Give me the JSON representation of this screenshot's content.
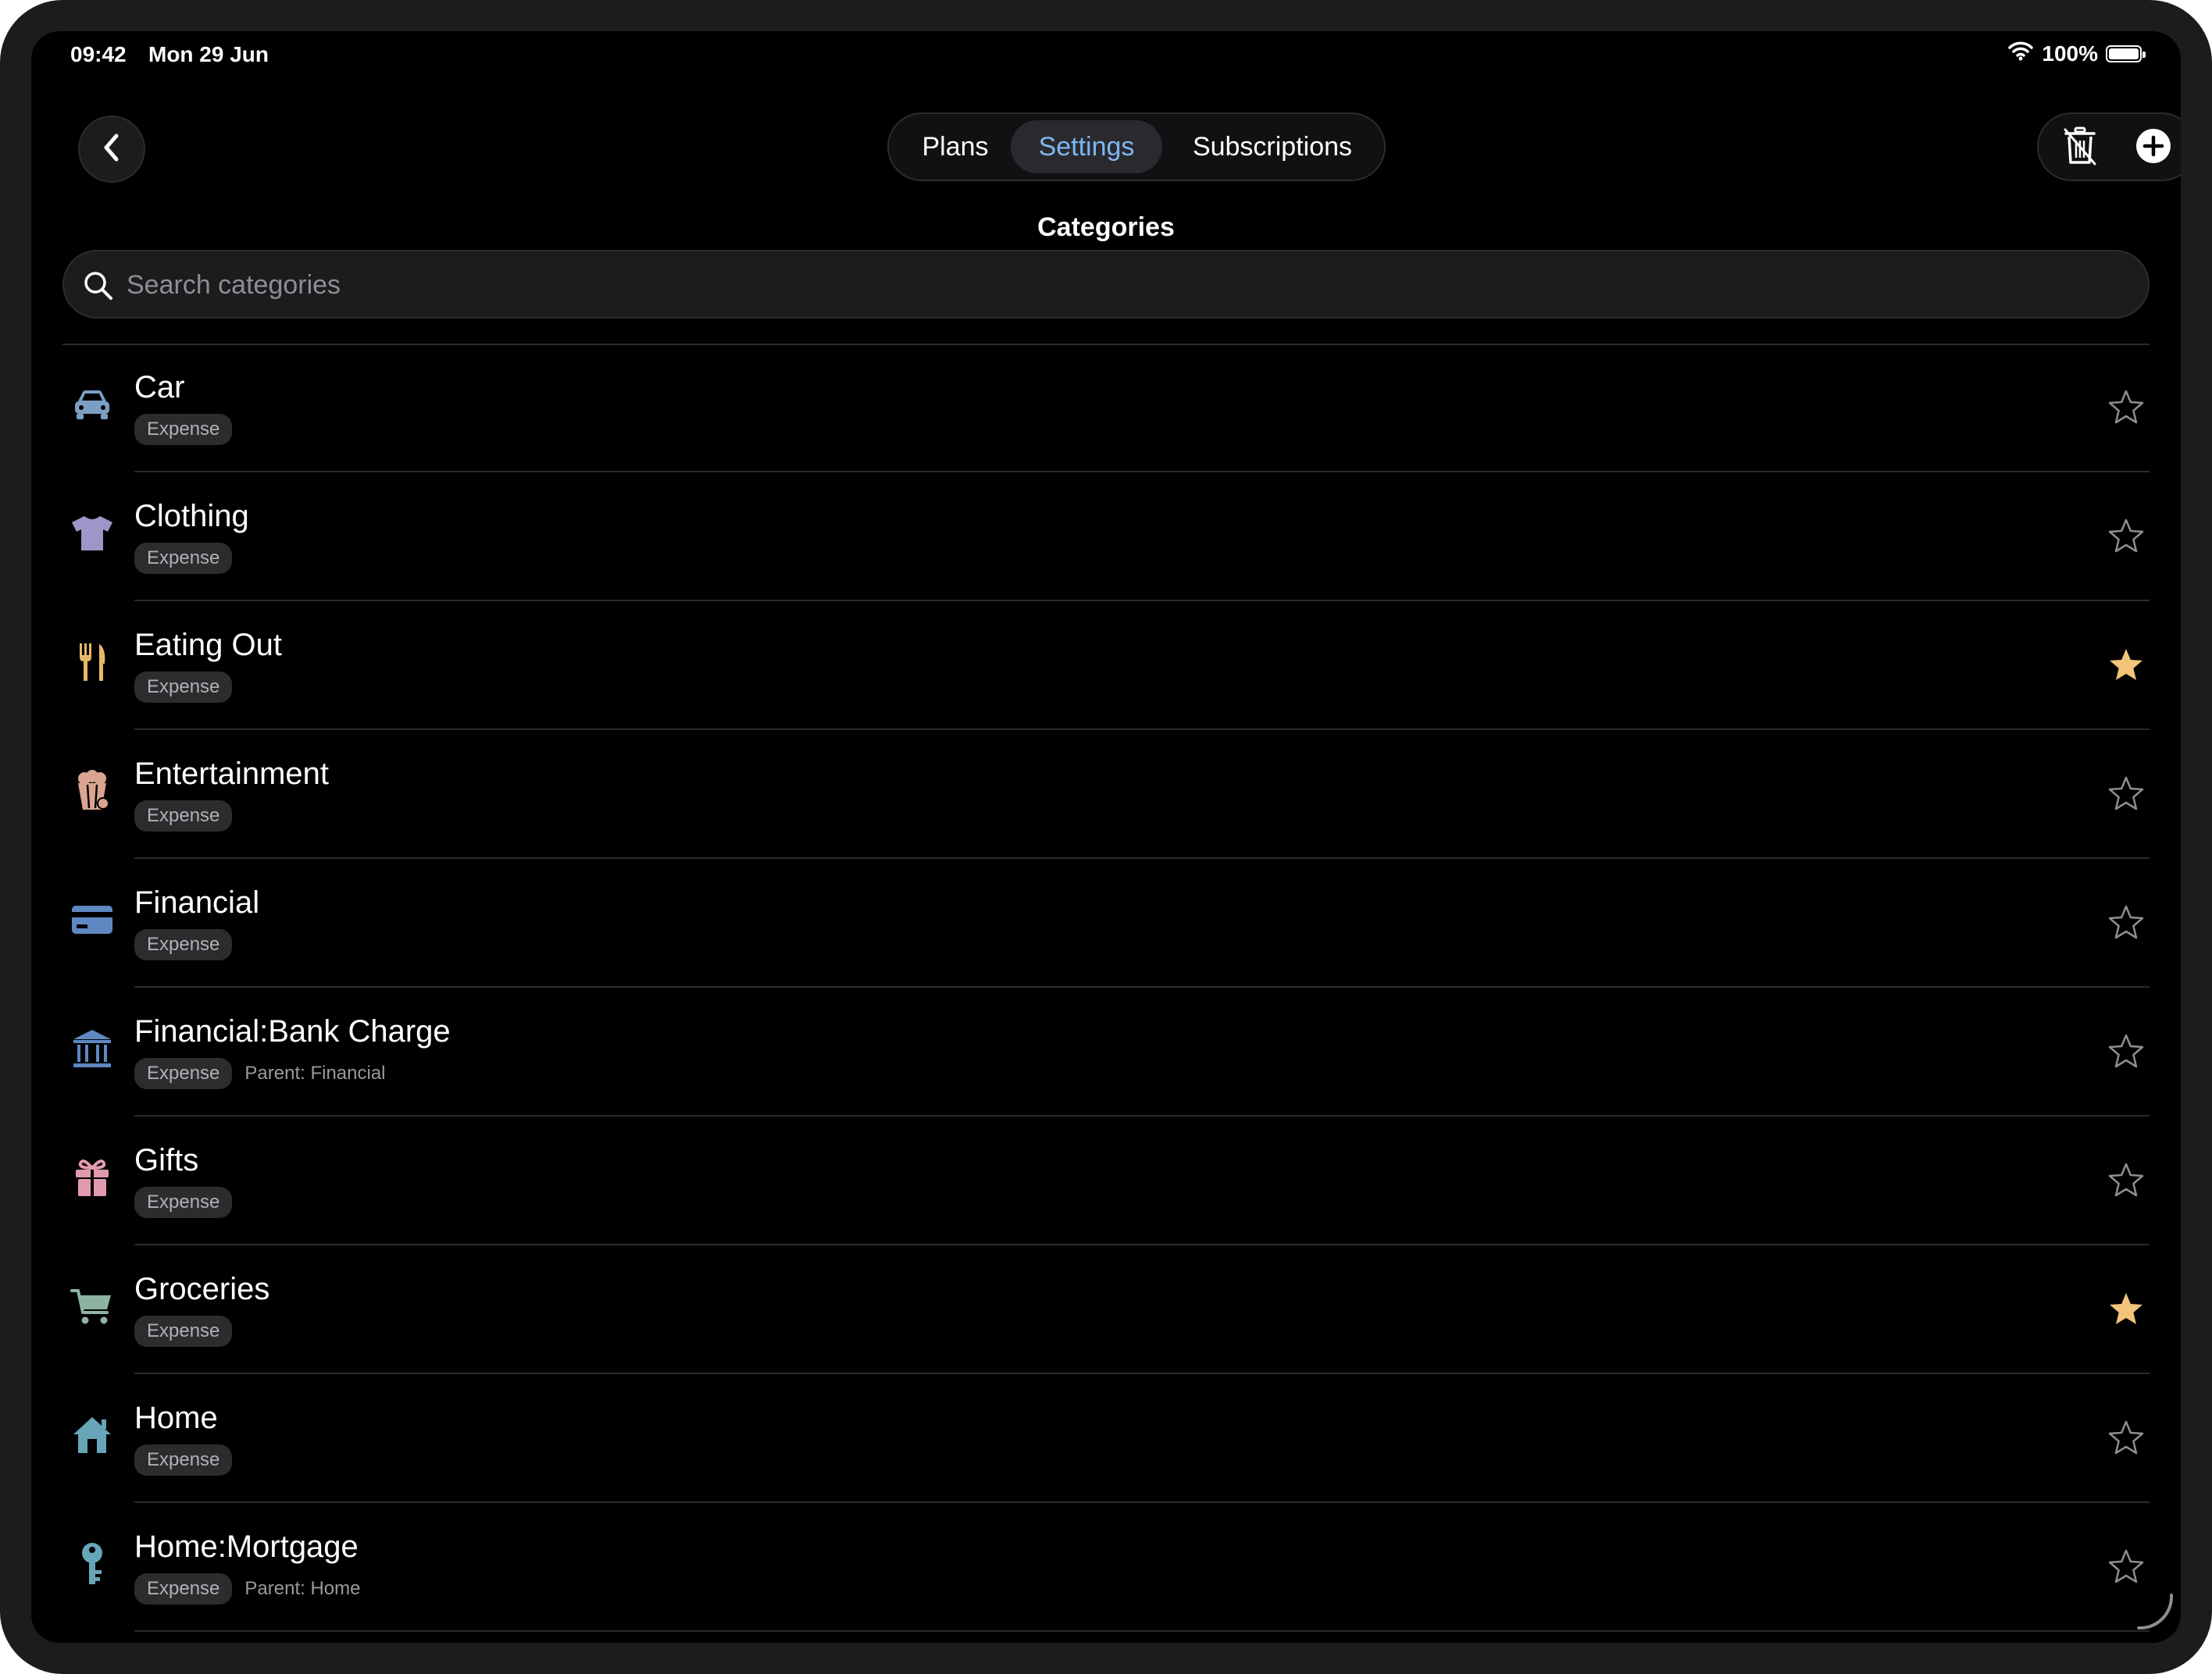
{
  "status_bar": {
    "time": "09:42",
    "date": "Mon 29 Jun",
    "battery": "100%",
    "battery_level": 1.0,
    "wifi_icon": "wifi-icon"
  },
  "toolbar": {
    "back_icon": "chevron-left-icon",
    "segments": [
      "Plans",
      "Settings",
      "Subscriptions"
    ],
    "selected_segment": "Settings",
    "trash_icon": "trash-icon",
    "add_icon": "plus-circle-icon"
  },
  "page": {
    "title": "Categories"
  },
  "search": {
    "placeholder": "Search categories",
    "value": ""
  },
  "colors": {
    "accent": "#7db8f4",
    "star_filled": "#f2c479",
    "star_empty": "#8e8e93",
    "background": "#000000"
  },
  "categories": [
    {
      "name": "Car",
      "type": "Expense",
      "parent": "",
      "icon": "car-icon",
      "icon_color": "#7b9fc4",
      "favorite": false
    },
    {
      "name": "Clothing",
      "type": "Expense",
      "parent": "",
      "icon": "tshirt-icon",
      "icon_color": "#9c97c8",
      "favorite": false
    },
    {
      "name": "Eating Out",
      "type": "Expense",
      "parent": "",
      "icon": "fork-knife-icon",
      "icon_color": "#e8b76a",
      "favorite": true
    },
    {
      "name": "Entertainment",
      "type": "Expense",
      "parent": "",
      "icon": "popcorn-icon",
      "icon_color": "#d9a591",
      "favorite": false
    },
    {
      "name": "Financial",
      "type": "Expense",
      "parent": "",
      "icon": "credit-card-icon",
      "icon_color": "#5f88c2",
      "favorite": false
    },
    {
      "name": "Financial:Bank Charge",
      "type": "Expense",
      "parent": "Parent: Financial",
      "icon": "bank-icon",
      "icon_color": "#5f88c2",
      "favorite": false
    },
    {
      "name": "Gifts",
      "type": "Expense",
      "parent": "",
      "icon": "gift-icon",
      "icon_color": "#e19aae",
      "favorite": false
    },
    {
      "name": "Groceries",
      "type": "Expense",
      "parent": "",
      "icon": "cart-icon",
      "icon_color": "#8fb3a2",
      "favorite": true
    },
    {
      "name": "Home",
      "type": "Expense",
      "parent": "",
      "icon": "house-icon",
      "icon_color": "#67a5b9",
      "favorite": false
    },
    {
      "name": "Home:Mortgage",
      "type": "Expense",
      "parent": "Parent: Home",
      "icon": "key-icon",
      "icon_color": "#67a5b9",
      "favorite": false
    }
  ]
}
